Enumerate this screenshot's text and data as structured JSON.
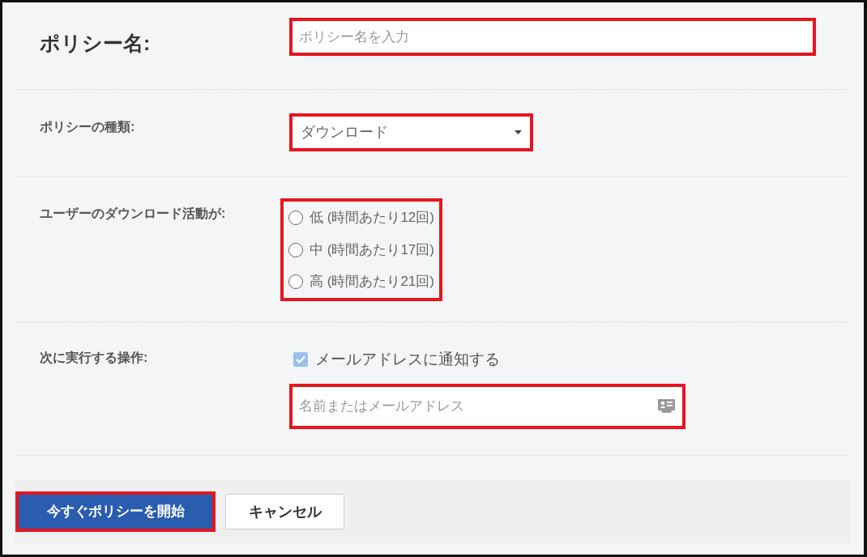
{
  "policy_name": {
    "label": "ポリシー名:",
    "placeholder": "ポリシー名を入力",
    "highlighted": true
  },
  "policy_type": {
    "label": "ポリシーの種類:",
    "value": "ダウンロード",
    "highlighted": true
  },
  "activity": {
    "label": "ユーザーのダウンロード活動が:",
    "highlighted": true,
    "options": [
      {
        "label": "低 (時間あたり12回)",
        "selected": false
      },
      {
        "label": "中 (時間あたり17回)",
        "selected": false
      },
      {
        "label": "高 (時間あたり21回)",
        "selected": false
      }
    ]
  },
  "action": {
    "label": "次に実行する操作:",
    "notify": {
      "label": "メールアドレスに通知する",
      "checked": true
    },
    "recipient": {
      "placeholder": "名前またはメールアドレス",
      "highlighted": true
    }
  },
  "footer": {
    "start_button": {
      "label": "今すぐポリシーを開始",
      "highlighted": true
    },
    "cancel_button": {
      "label": "キャンセル",
      "highlighted": false
    }
  }
}
